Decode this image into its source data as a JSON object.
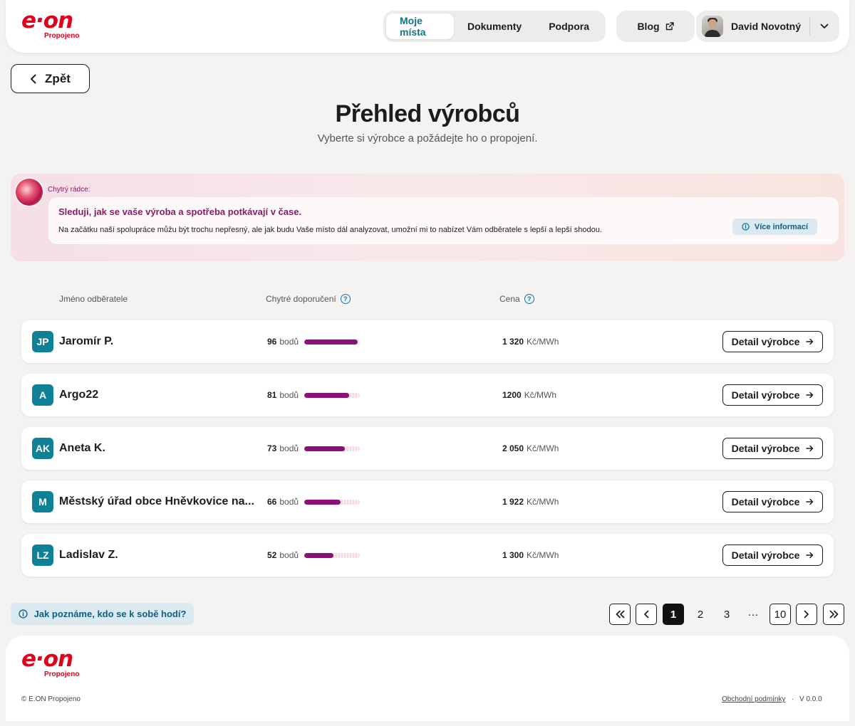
{
  "brand": {
    "logo_text": "e·on",
    "logo_sub": "Propojeno",
    "color": "#e2001a"
  },
  "header": {
    "nav": [
      {
        "label": "Moje místa",
        "active": true
      },
      {
        "label": "Dokumenty",
        "active": false
      },
      {
        "label": "Podpora",
        "active": false
      }
    ],
    "blog_label": "Blog",
    "blog_icon": "external-link-icon",
    "user_name": "David Novotný",
    "user_menu_icon": "chevron-down-icon"
  },
  "back_label": "Zpět",
  "page": {
    "title": "Přehled výrobců",
    "subtitle": "Vyberte si výrobce a požádejte ho o propojení."
  },
  "advisor": {
    "label": "Chytrý rádce:",
    "heading": "Sleduji, jak se vaše výroba a spotřeba potkávají v čase.",
    "text": "Na začátku naší spolupráce můžu být trochu nepřesný, ale jak budu Vaše místo dál analyzovat, umožní mi to nabízet Vám odběratele s lepší a lepší shodou.",
    "more_label": "Více informací",
    "accent": "#8b1a6b"
  },
  "table": {
    "columns": {
      "name": "Jméno odběratele",
      "recommendation": "Chytré doporučení",
      "price": "Cena"
    },
    "score_unit": "bodů",
    "price_unit": "Kč/MWh",
    "detail_label": "Detail výrobce",
    "rows": [
      {
        "initials": "JP",
        "name": "Jaromír P.",
        "score": "96",
        "score_value": 96,
        "price": "1 320"
      },
      {
        "initials": "A",
        "name": "Argo22",
        "score": "81",
        "score_value": 81,
        "price": "1200"
      },
      {
        "initials": "AK",
        "name": "Aneta K.",
        "score": "73",
        "score_value": 73,
        "price": "2 050"
      },
      {
        "initials": "M",
        "name": "Městský úřad obce Hněvkovice na...",
        "score": "66",
        "score_value": 66,
        "price": "1 922"
      },
      {
        "initials": "LZ",
        "name": "Ladislav Z.",
        "score": "52",
        "score_value": 52,
        "price": "1 300"
      }
    ]
  },
  "how_label": "Jak poznáme, kdo se k sobě hodí?",
  "pagination": {
    "first": "«",
    "prev": "‹",
    "pages": [
      "1",
      "2",
      "3"
    ],
    "ellipsis": "···",
    "last_page": "10",
    "next": "›",
    "last": "»",
    "current": "1"
  },
  "footer": {
    "copyright": "© E.ON Propojeno",
    "terms": "Obchodní podmínky",
    "separator": "·",
    "version": "V 0.0.0"
  }
}
